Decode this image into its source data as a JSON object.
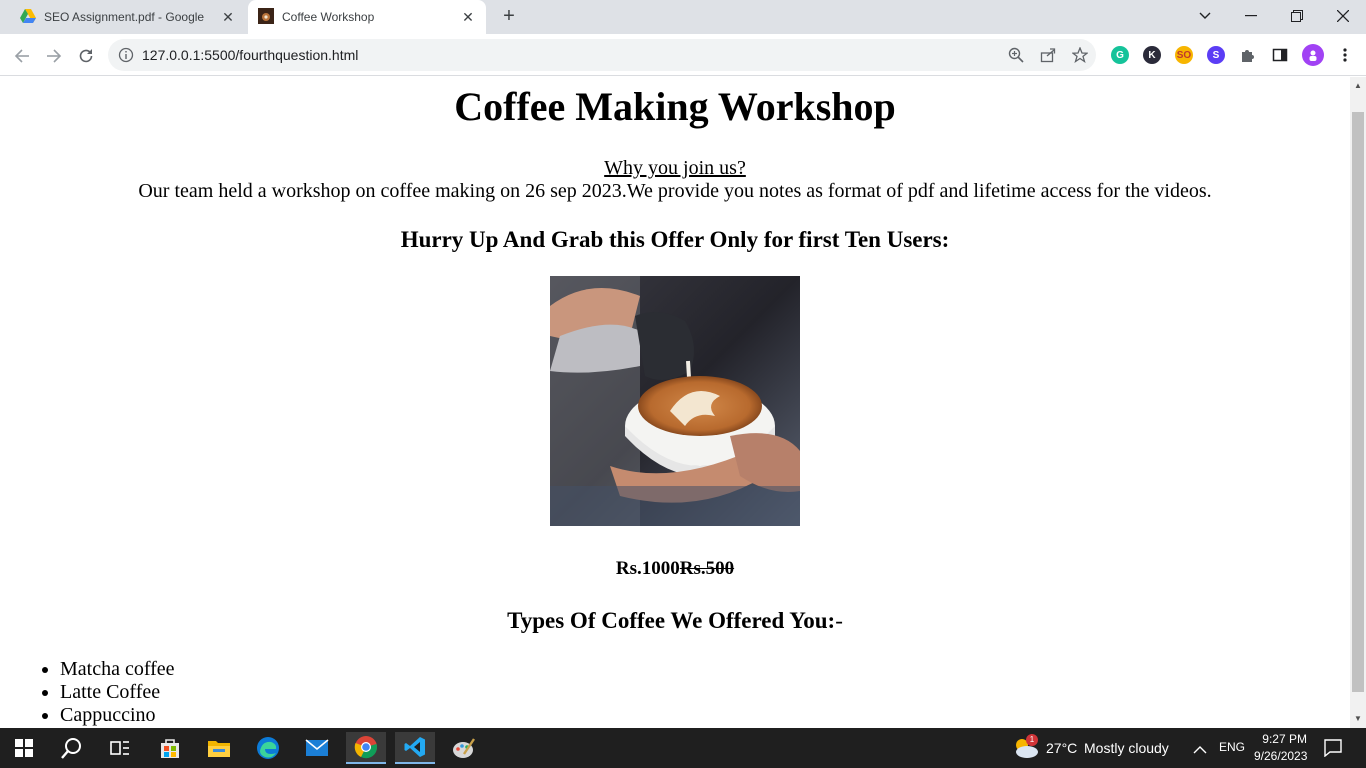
{
  "browser": {
    "tabs": [
      {
        "title": "SEO Assignment.pdf - Google D",
        "icon": "google-drive-icon"
      },
      {
        "title": "Coffee Workshop",
        "icon": "coffee-favicon"
      }
    ],
    "address": "127.0.0.1:5500/fourthquestion.html"
  },
  "page": {
    "title": "Coffee Making Workshop",
    "why_heading": "Why you join us?",
    "description": "Our team held a workshop on coffee making on 26 sep 2023.We provide you notes as format of pdf and lifetime access for the videos.",
    "offer_heading": "Hurry Up And Grab this Offer Only for first Ten Users:",
    "image_alt": "Latte art being poured into a white cup",
    "price_new": "Rs.1000",
    "price_old": "Rs.500",
    "types_heading": "Types Of Coffee We Offered You:",
    "types_dash": "-",
    "coffee_types": [
      "Matcha coffee",
      "Latte Coffee",
      "Cappuccino"
    ]
  },
  "taskbar": {
    "weather_temp": "27°C",
    "weather_desc": "Mostly cloudy",
    "weather_badge": "1",
    "lang": "ENG",
    "time": "9:27 PM",
    "date": "9/26/2023"
  },
  "colors": {
    "tabstrip": "#dee1e6",
    "taskbar": "#1f1f1f",
    "vscode": "#23a9f2",
    "chrome_red": "#db4437"
  }
}
